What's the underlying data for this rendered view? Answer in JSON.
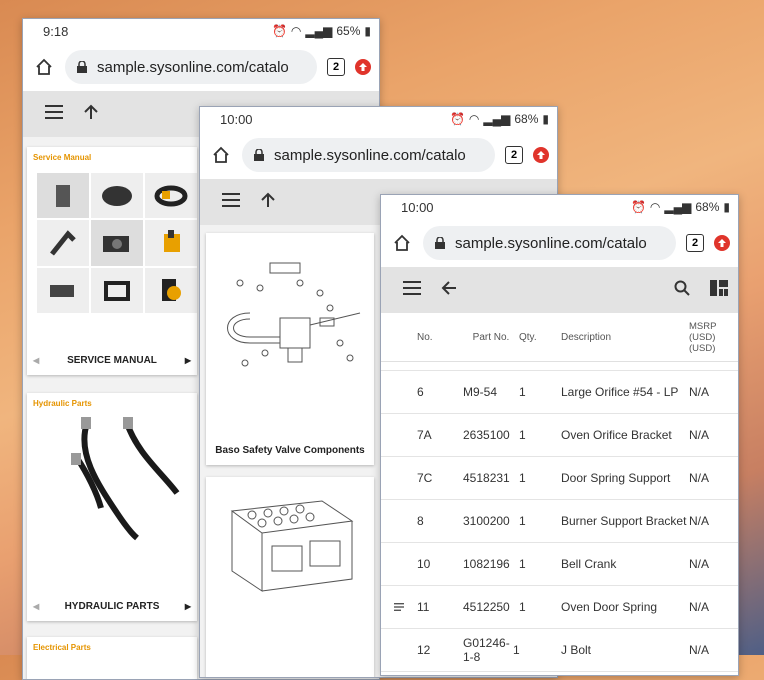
{
  "phone1": {
    "status": {
      "time": "9:18",
      "battery": "65%"
    },
    "url": "sample.sysonline.com/catalo",
    "tab_count": "2",
    "cards": [
      {
        "category": "Service Manual",
        "title": "SERVICE MANUAL"
      },
      {
        "category": "Hydraulic Parts",
        "title": "HYDRAULIC PARTS"
      },
      {
        "category": "Electrical Parts",
        "title": ""
      }
    ]
  },
  "phone2": {
    "status": {
      "time": "10:00",
      "battery": "68%"
    },
    "url": "sample.sysonline.com/catalo",
    "tab_count": "2",
    "cards": [
      {
        "title": "Baso Safety Valve Components"
      }
    ]
  },
  "phone3": {
    "status": {
      "time": "10:00",
      "battery": "68%"
    },
    "url": "sample.sysonline.com/catalo",
    "tab_count": "2",
    "table": {
      "headers": {
        "no": "No.",
        "part_no": "Part No.",
        "qty": "Qty.",
        "description": "Description",
        "msrp": "MSRP (USD) (USD)"
      },
      "rows": [
        {
          "no": "6",
          "part": "M9-54",
          "qty": "1",
          "desc": "Large Orifice #54 - LP",
          "msrp": "N/A"
        },
        {
          "no": "7A",
          "part": "2635100",
          "qty": "1",
          "desc": "Oven Orifice Bracket",
          "msrp": "N/A"
        },
        {
          "no": "7C",
          "part": "4518231",
          "qty": "1",
          "desc": "Door Spring Support",
          "msrp": "N/A"
        },
        {
          "no": "8",
          "part": "3100200",
          "qty": "1",
          "desc": "Burner Support Bracket",
          "msrp": "N/A"
        },
        {
          "no": "10",
          "part": "1082196",
          "qty": "1",
          "desc": "Bell Crank",
          "msrp": "N/A"
        },
        {
          "no": "11",
          "part": "4512250",
          "qty": "1",
          "desc": "Oven Door Spring",
          "msrp": "N/A"
        },
        {
          "no": "12",
          "part": "G01246-1-8",
          "qty": "1",
          "desc": "J Bolt",
          "msrp": "N/A"
        }
      ]
    }
  },
  "icons": {
    "home": "home-icon",
    "lock": "lock-icon",
    "menu": "hamburger-menu-icon",
    "up": "arrow-up-icon",
    "back": "arrow-back-icon",
    "search": "search-icon",
    "grid": "grid-view-icon",
    "update": "update-icon"
  },
  "colors": {
    "accent_orange": "#e59400",
    "update_red": "#e0342b",
    "toolbar_gray": "#e3e3e3"
  }
}
